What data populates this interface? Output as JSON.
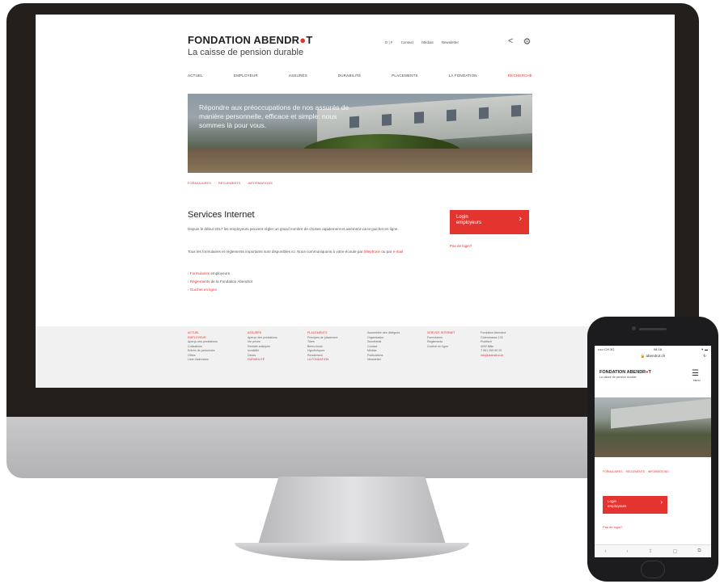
{
  "desktop": {
    "logo": {
      "text": "FONDATION ABENDR",
      "accent": "●",
      "end": "T"
    },
    "tagline": "La caisse de pension durable",
    "topbar": [
      "D | F",
      "Contact",
      "Médias",
      "Newsletter"
    ],
    "top_icons": {
      "share": "share-icon",
      "search": "search-icon"
    },
    "nav": [
      "ACTUEL",
      "EMPLOYEUR",
      "ASSURÉS",
      "DURABILITÉ",
      "PLACEMENTS",
      "LA FONDATION",
      "RECHERCHE"
    ],
    "hero_text": "Répondre aux préoccupations de nos assurés de manière personnelle, efficace et simple: nous sommes là pour vous.",
    "breadcrumb": [
      "FORMULAIRES",
      "RÈGLEMENTS",
      "INFORMATIONS"
    ],
    "title": "Services Internet",
    "para1": "Depuis le début 2017 les employeurs peuvent régler un grand nombre de choses rapidement et aisément via le guichet en ligne.",
    "para2_a": "Tous les formulaires et règlements importants sont disponibles ici. Nous communiquons à votre écoute par ",
    "para2_b": "téléphone",
    "para2_c": " ou par ",
    "para2_d": "e-mail",
    "links": [
      {
        "red": "Formulaires",
        "rest": " employeurs"
      },
      {
        "red": "Règlements",
        "rest": " de la Fondation Abendrot"
      },
      {
        "red": "Guichet en ligne",
        "rest": ""
      }
    ],
    "login": {
      "line1": "Login",
      "line2": "employeurs",
      "arrow": "›"
    },
    "forgot": "Pas de login?",
    "footer": [
      {
        "items": [
          [
            "h",
            "ACTUEL"
          ],
          [
            "h",
            "EMPLOYEUR"
          ],
          [
            "",
            "Aperçu des prestations"
          ],
          [
            "",
            "Cotisations"
          ],
          [
            "",
            "Entrée de personnes"
          ],
          [
            "",
            "Offres"
          ],
          [
            "",
            "Liste d'adresses"
          ]
        ]
      },
      {
        "items": [
          [
            "h",
            "ASSURÉS"
          ],
          [
            "",
            "Aperçu des prestations"
          ],
          [
            "",
            "Vie privée"
          ],
          [
            "",
            "Retraite anticipée"
          ],
          [
            "",
            "Invalidité"
          ],
          [
            "",
            "Décès"
          ],
          [
            "h",
            "DURABILITÉ"
          ]
        ]
      },
      {
        "items": [
          [
            "h",
            "PLACEMENTS"
          ],
          [
            "",
            "Principes de placement"
          ],
          [
            "",
            "Titres"
          ],
          [
            "",
            "Biens-fonds"
          ],
          [
            "",
            "Hypothèques"
          ],
          [
            "",
            "Rendement"
          ],
          [
            "h",
            "LA FONDATION"
          ]
        ]
      },
      {
        "items": [
          [
            "",
            "Assemblée des délégués"
          ],
          [
            "",
            "Organisation"
          ],
          [
            "",
            "Secrétariat"
          ],
          [
            "",
            "Contact"
          ],
          [
            "",
            "Médias"
          ],
          [
            "",
            "Publications"
          ],
          [
            "",
            "Newsletter"
          ]
        ]
      },
      {
        "items": [
          [
            "h",
            "SERVICE INTERNET"
          ],
          [
            "",
            "Formulaires"
          ],
          [
            "",
            "Règlements"
          ],
          [
            "",
            "Guichet en ligne"
          ]
        ]
      },
      {
        "items": [
          [
            "",
            "Fondation Abendrot"
          ],
          [
            "",
            "Güterstrasse 133"
          ],
          [
            "",
            "Postfach"
          ],
          [
            "",
            "4002 Bâle"
          ],
          [
            "",
            ""
          ],
          [
            "",
            "T 061 269 90 20"
          ],
          [
            "h",
            "info@abendrot.ch"
          ]
        ]
      }
    ]
  },
  "phone": {
    "status_left": "••••• CH  3G",
    "status_center": "08:18",
    "status_right": "⁕ ▬",
    "url": "🔒 abendrot.ch",
    "reload": "↻",
    "logo": {
      "text": "FONDATION ABENDR",
      "accent": "●",
      "end": "T"
    },
    "tagline": "La caisse de pension durable",
    "menu_icon": "☰",
    "menu_label": "MENU",
    "breadcrumb": [
      "FORMULAIRES",
      "RÈGLEMENTS",
      "INFORMATIONS"
    ],
    "login": {
      "line1": "Login",
      "line2": "employeurs",
      "arrow": "›"
    },
    "forgot": "Pas de login?",
    "toolbar": [
      "‹",
      "›",
      "⇪",
      "▢",
      "⧉"
    ]
  }
}
